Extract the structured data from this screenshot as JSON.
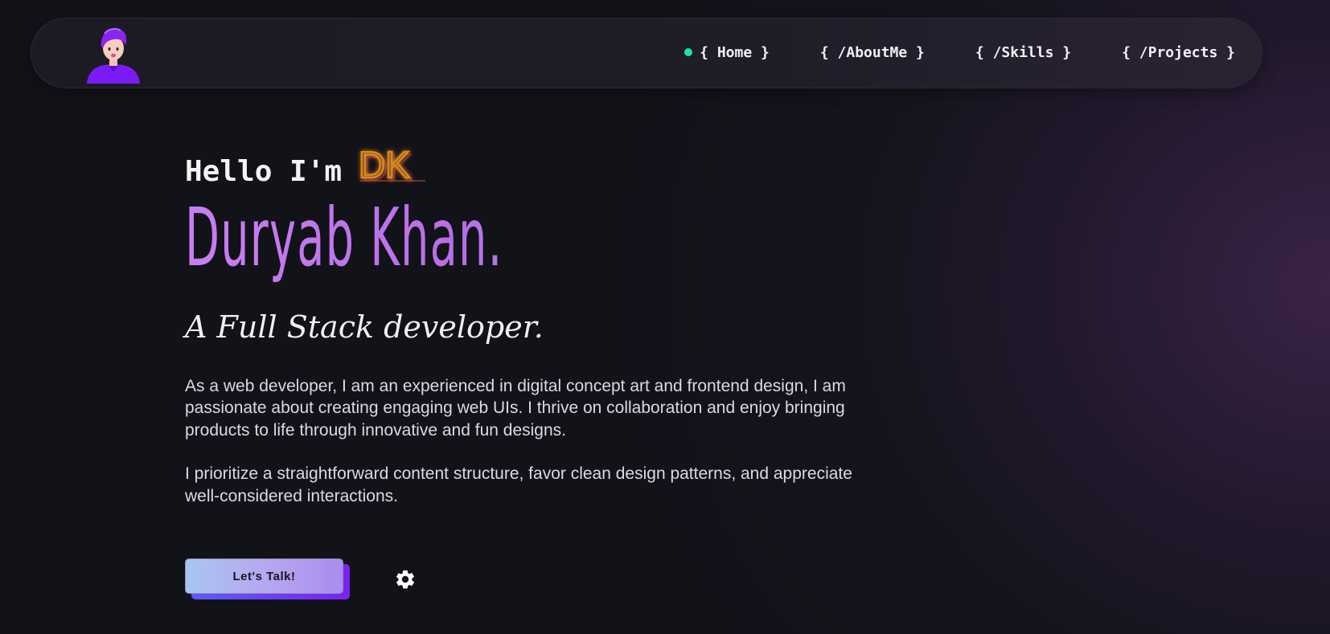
{
  "nav": {
    "avatar_icon": "developer-avatar-icon",
    "active_indicator_color": "#22e39a",
    "items": [
      {
        "label": "{ Home }",
        "active": true
      },
      {
        "label": "{ /AboutMe }",
        "active": false
      },
      {
        "label": "{ /Skills }",
        "active": false
      },
      {
        "label": "{ /Projects }",
        "active": false
      }
    ]
  },
  "hero": {
    "greeting": "Hello I'm",
    "logo_text": "DK",
    "name": "Duryab Khan.",
    "tagline": "A Full Stack developer.",
    "bio": [
      "As a web developer, I am an experienced in digital concept art and frontend design, I am passionate about creating engaging web UIs. I thrive on collaboration and enjoy bringing products to life through innovative and fun designs.",
      "I prioritize a straightforward content structure, favor clean design patterns, and appreciate well-considered interactions."
    ],
    "cta_label": "Let's Talk!",
    "settings_icon": "gear-icon"
  },
  "colors": {
    "name_gradient_start": "#c87ff0",
    "name_gradient_end": "#b49cf0",
    "logo_color": "#d98a1a",
    "cta_gradient_start": "#a8c6f3",
    "cta_gradient_end": "#a98cf0",
    "cta_shadow": "#7a22f2"
  }
}
